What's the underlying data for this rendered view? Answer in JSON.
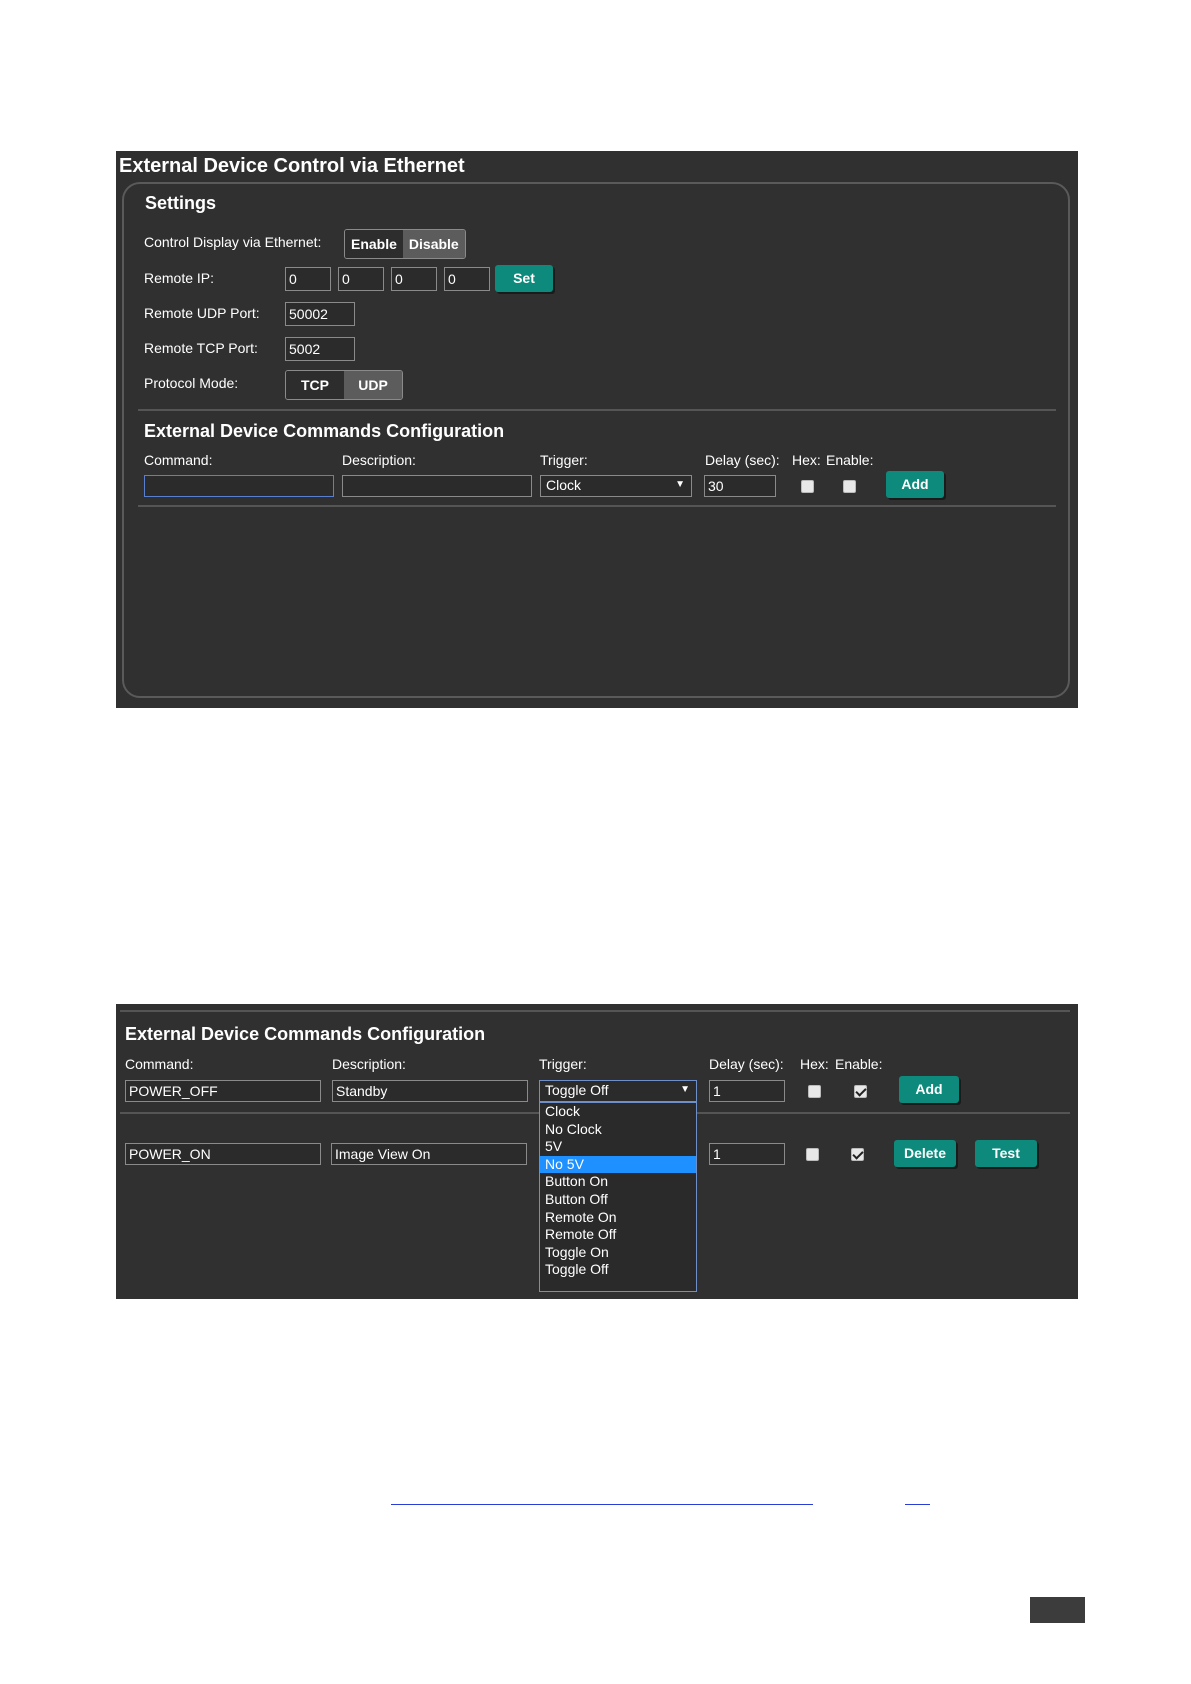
{
  "panel1": {
    "title": "External Device Control via Ethernet",
    "settings": {
      "heading": "Settings",
      "control_display_label": "Control Display via Ethernet:",
      "enable_label": "Enable",
      "disable_label": "Disable",
      "remote_ip_label": "Remote IP:",
      "ip_octets": [
        "0",
        "0",
        "0",
        "0"
      ],
      "set_label": "Set",
      "udp_port_label": "Remote UDP Port:",
      "udp_port_value": "50002",
      "tcp_port_label": "Remote TCP Port:",
      "tcp_port_value": "5002",
      "protocol_label": "Protocol Mode:",
      "tcp_label": "TCP",
      "udp_label": "UDP"
    },
    "commands": {
      "heading": "External Device Commands Configuration",
      "command_label": "Command:",
      "description_label": "Description:",
      "trigger_label": "Trigger:",
      "delay_label": "Delay (sec):",
      "hex_label": "Hex:",
      "enable_label": "Enable:",
      "command_value": "",
      "description_value": "",
      "trigger_value": "Clock",
      "delay_value": "30",
      "add_label": "Add"
    }
  },
  "panel2": {
    "heading": "External Device Commands Configuration",
    "command_label": "Command:",
    "description_label": "Description:",
    "trigger_label": "Trigger:",
    "delay_label": "Delay (sec):",
    "hex_label": "Hex:",
    "enable_label": "Enable:",
    "row_new": {
      "command": "POWER_OFF",
      "description": "Standby",
      "trigger": "Toggle Off",
      "delay": "1",
      "hex": false,
      "enable": true,
      "add_label": "Add"
    },
    "row_saved": {
      "command": "POWER_ON",
      "description": "Image View On",
      "delay": "1",
      "hex": false,
      "enable": true,
      "delete_label": "Delete",
      "test_label": "Test"
    },
    "trigger_options": [
      "Clock",
      "No Clock",
      "5V",
      "No 5V",
      "Button On",
      "Button Off",
      "Remote On",
      "Remote Off",
      "Toggle On",
      "Toggle Off"
    ],
    "highlighted_option": "No 5V"
  }
}
